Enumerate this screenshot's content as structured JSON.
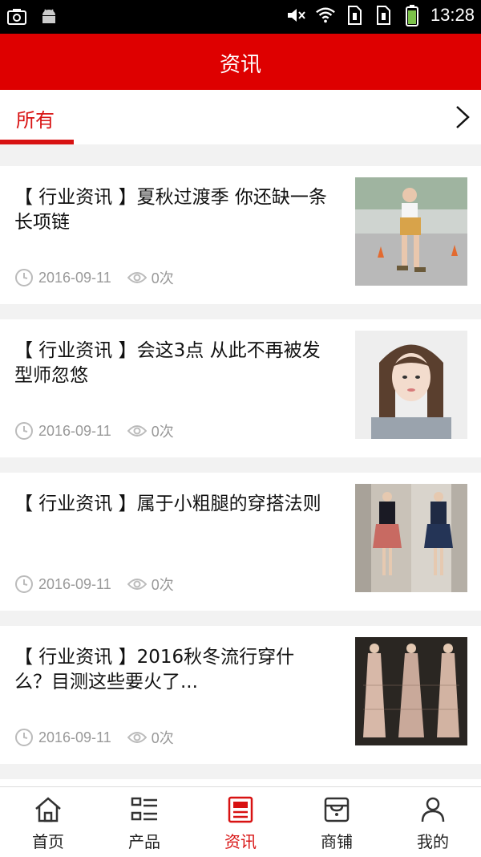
{
  "status_bar": {
    "time": "13:28"
  },
  "header": {
    "title": "资讯"
  },
  "tabs": {
    "active_label": "所有"
  },
  "articles": [
    {
      "title": "【 行业资讯 】夏秋过渡季 你还缺一条长项链",
      "date": "2016-09-11",
      "views": "0次"
    },
    {
      "title": "【 行业资讯 】会这3点 从此不再被发型师忽悠",
      "date": "2016-09-11",
      "views": "0次"
    },
    {
      "title": "【 行业资讯 】属于小粗腿的穿搭法则",
      "date": "2016-09-11",
      "views": "0次"
    },
    {
      "title": "【 行业资讯 】2016秋冬流行穿什么？目测这些要火了...",
      "date": "2016-09-11",
      "views": "0次"
    }
  ],
  "bottom_nav": [
    {
      "label": "首页"
    },
    {
      "label": "产品"
    },
    {
      "label": "资讯"
    },
    {
      "label": "商铺"
    },
    {
      "label": "我的"
    }
  ],
  "colors": {
    "accent": "#de0000",
    "tab_red": "#d81212",
    "meta_gray": "#999999"
  }
}
